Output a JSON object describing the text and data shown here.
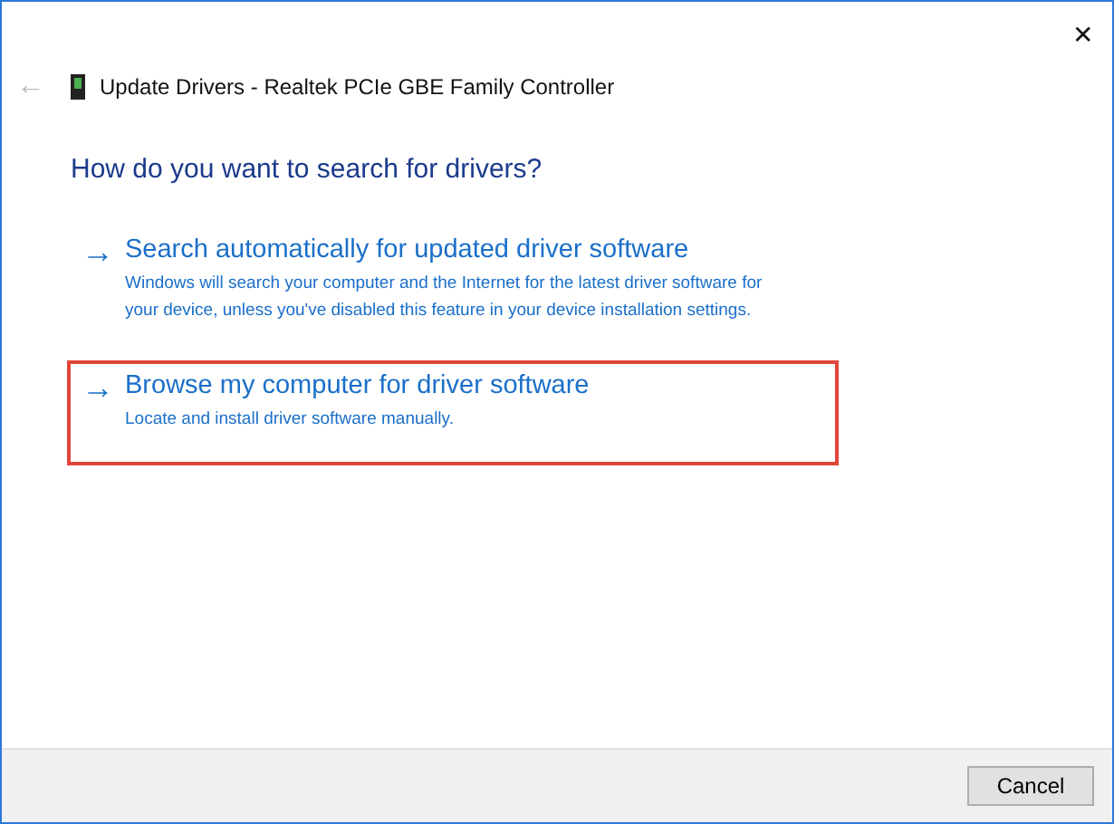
{
  "window": {
    "title": "Update Drivers - Realtek PCIe GBE Family Controller",
    "close": "✕",
    "back": "←"
  },
  "heading": "How do you want to search for drivers?",
  "options": [
    {
      "arrow": "→",
      "title": "Search automatically for updated driver software",
      "description": "Windows will search your computer and the Internet for the latest driver software for your device, unless you've disabled this feature in your device installation settings.",
      "selected": false
    },
    {
      "arrow": "→",
      "title": "Browse my computer for driver software",
      "description": "Locate and install driver software manually.",
      "selected": true
    }
  ],
  "buttons": [
    "Cancel"
  ]
}
